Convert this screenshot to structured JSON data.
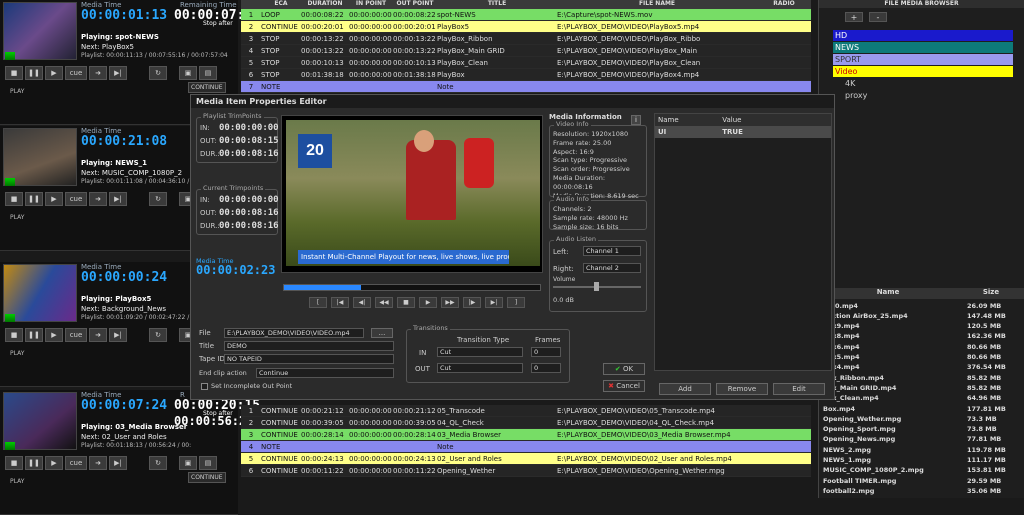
{
  "channels": [
    {
      "media_time_label": "Media Time",
      "media_time": "00:00:01:13",
      "remaining_label": "Remaining Time",
      "remaining": "00:00:07:09",
      "stop_after": "Stop after",
      "playing": "Playing: spot-NEWS",
      "next": "Next: PlayBox5",
      "playlist": "Playlist: 00:00:11:13 / 00:07:55:16 / 00:07:57:04",
      "mode": "CONTINUE",
      "state": "PLAY"
    },
    {
      "media_time_label": "Media Time",
      "media_time": "00:00:21:08",
      "remaining_label": "",
      "remaining": "",
      "stop_after": "",
      "playing": "Playing: NEWS_1",
      "next": "Next: MUSIC_COMP_1080P_2",
      "playlist": "Playlist: 00:01:11:08 / 00:04:36:10 / 00:",
      "mode": "",
      "state": "PLAY"
    },
    {
      "media_time_label": "Media Time",
      "media_time": "00:00:00:24",
      "remaining_label": "",
      "remaining": "",
      "stop_after": "",
      "playing": "Playing: PlayBox5",
      "next": "Next: Background_News",
      "playlist": "Playlist: 00:01:09:20 / 00:02:47:22 / 00:",
      "mode": "",
      "state": "PLAY"
    },
    {
      "media_time_label": "Media Time",
      "media_time": "00:00:07:24",
      "remaining_label": "R",
      "remaining": "00:00:20:15",
      "stop_after": "Stop after",
      "playing": "Playing: 03_Media Browser",
      "next": "Next: 02_User and Roles",
      "playlist": "Playlist: 00:01:18:13 / 00:56:24 / 00:",
      "mode": "CONTINUE",
      "state": "PLAY",
      "extra_time": "00:00:56:24"
    }
  ],
  "top_table": {
    "headers": [
      "",
      "ECA",
      "DURATION",
      "IN POINT",
      "OUT POINT",
      "TITLE",
      "FILE NAME",
      "RADIO"
    ],
    "rows": [
      {
        "n": "1",
        "eca": "LOOP",
        "dur": "00:00:08:22",
        "in": "00:00:00:00",
        "out": "00:00:08:22",
        "title": "spot-NEWS",
        "file": "E:\\Capture\\spot-NEWS.mov",
        "style": "green"
      },
      {
        "n": "2",
        "eca": "CONTINUE",
        "dur": "00:00:20:01",
        "in": "00:00:00:00",
        "out": "00:00:20:01",
        "title": "PlayBox5",
        "file": "E:\\PLAYBOX_DEMO\\VIDEO\\PlayBox5.mp4",
        "style": "yellow"
      },
      {
        "n": "3",
        "eca": "STOP",
        "dur": "00:00:13:22",
        "in": "00:00:00:00",
        "out": "00:00:13:22",
        "title": "PlayBox_Ribbon",
        "file": "E:\\PLAYBOX_DEMO\\VIDEO\\PlayBox_Ribbo",
        "style": "dark"
      },
      {
        "n": "4",
        "eca": "STOP",
        "dur": "00:00:13:22",
        "in": "00:00:00:00",
        "out": "00:00:13:22",
        "title": "PlayBox_Main GRID",
        "file": "E:\\PLAYBOX_DEMO\\VIDEO\\PlayBox_Main",
        "style": "dark"
      },
      {
        "n": "5",
        "eca": "STOP",
        "dur": "00:00:10:13",
        "in": "00:00:00:00",
        "out": "00:00:10:13",
        "title": "PlayBox_Clean",
        "file": "E:\\PLAYBOX_DEMO\\VIDEO\\PlayBox_Clean",
        "style": "dark"
      },
      {
        "n": "6",
        "eca": "STOP",
        "dur": "00:01:38:18",
        "in": "00:00:00:00",
        "out": "00:01:38:18",
        "title": "PlayBox",
        "file": "E:\\PLAYBOX_DEMO\\VIDEO\\PlayBox4.mp4",
        "style": "dark"
      },
      {
        "n": "7",
        "eca": "NOTE",
        "dur": "",
        "in": "",
        "out": "",
        "title": "Note",
        "file": "",
        "style": "blue"
      }
    ]
  },
  "bottom_table": {
    "rows": [
      {
        "n": "1",
        "eca": "CONTINUE",
        "dur": "00:00:21:12",
        "in": "00:00:00:00",
        "out": "00:00:21:12",
        "title": "05_Transcode",
        "file": "E:\\PLAYBOX_DEMO\\VIDEO\\05_Transcode.mp4",
        "style": "dark"
      },
      {
        "n": "2",
        "eca": "CONTINUE",
        "dur": "00:00:39:05",
        "in": "00:00:00:00",
        "out": "00:00:39:05",
        "title": "04_QL_Check",
        "file": "E:\\PLAYBOX_DEMO\\VIDEO\\04_QL_Check.mp4",
        "style": "dark"
      },
      {
        "n": "3",
        "eca": "CONTINUE",
        "dur": "00:00:28:14",
        "in": "00:00:00:00",
        "out": "00:00:28:14",
        "title": "03_Media Browser",
        "file": "E:\\PLAYBOX_DEMO\\VIDEO\\03_Media Browser.mp4",
        "style": "green"
      },
      {
        "n": "4",
        "eca": "NOTE",
        "dur": "",
        "in": "",
        "out": "",
        "title": "Note",
        "file": "",
        "style": "blue"
      },
      {
        "n": "5",
        "eca": "CONTINUE",
        "dur": "00:00:24:13",
        "in": "00:00:00:00",
        "out": "00:00:24:13",
        "title": "02_User and Roles",
        "file": "E:\\PLAYBOX_DEMO\\VIDEO\\02_User and Roles.mp4",
        "style": "yellow"
      },
      {
        "n": "6",
        "eca": "CONTINUE",
        "dur": "00:00:11:22",
        "in": "00:00:00:00",
        "out": "00:00:11:22",
        "title": "Opening_Wether",
        "file": "E:\\PLAYBOX_DEMO\\VIDEO\\Opening_Wether.mpg",
        "style": "dark"
      }
    ]
  },
  "browser": {
    "title": "FILE MEDIA BROWSER",
    "btn_add": "+",
    "btn_remove": "-",
    "categories": [
      {
        "label": "HD",
        "color": "#1a1acc",
        "text": "#fff"
      },
      {
        "label": "NEWS",
        "color": "#0d7a7a",
        "text": "#fff"
      },
      {
        "label": "SPORT",
        "color": "#9a9aee",
        "text": "#333"
      },
      {
        "label": "Video",
        "color": "#ffff00",
        "text": "#c00"
      }
    ],
    "sub": [
      "4K",
      "proxy"
    ],
    "file_headers": [
      "Name",
      "Size"
    ],
    "files": [
      {
        "name": "y_40.mp4",
        "size": "26.09 MB"
      },
      {
        "name": "duction AirBox_25.mp4",
        "size": "147.48 MB"
      },
      {
        "name": "Box9.mp4",
        "size": "120.5 MB"
      },
      {
        "name": "Box8.mp4",
        "size": "162.36 MB"
      },
      {
        "name": "Box6.mp4",
        "size": "80.66 MB"
      },
      {
        "name": "Box5.mp4",
        "size": "80.66 MB"
      },
      {
        "name": "Box4.mp4",
        "size": "376.54 MB"
      },
      {
        "name": "Box_Ribbon.mp4",
        "size": "85.82 MB"
      },
      {
        "name": "Box_Main GRID.mp4",
        "size": "85.82 MB"
      },
      {
        "name": "Box_Clean.mp4",
        "size": "64.96 MB"
      },
      {
        "name": "Box.mp4",
        "size": "177.81 MB"
      },
      {
        "name": "Opening_Wether.mpg",
        "size": "73.3 MB"
      },
      {
        "name": "Opening_Sport.mpg",
        "size": "73.8 MB"
      },
      {
        "name": "Opening_News.mpg",
        "size": "77.81 MB"
      },
      {
        "name": "NEWS_2.mpg",
        "size": "119.78 MB"
      },
      {
        "name": "NEWS_1.mpg",
        "size": "111.17 MB"
      },
      {
        "name": "MUSIC_COMP_1080P_2.mpg",
        "size": "153.81 MB"
      },
      {
        "name": "Football TIMER.mpg",
        "size": "29.59 MB"
      },
      {
        "name": "football2.mpg",
        "size": "35.06 MB"
      }
    ]
  },
  "dialog": {
    "title": "Media Item Properties Editor",
    "playlist_trim_label": "Playlist TrimPoints",
    "current_trim_label": "Current Trimpoints",
    "in_label": "IN:",
    "out_label": "OUT:",
    "dur_label": "DUR.:",
    "pl_in": "00:00:00:00",
    "pl_out": "00:00:08:15",
    "pl_dur": "00:00:08:16",
    "cur_in": "00:00:00:00",
    "cur_out": "00:00:08:16",
    "cur_dur": "00:00:08:16",
    "media_time_label": "Media Time",
    "media_time": "00:00:02:23",
    "caption": "Instant Multi-Channel Playout for news, live shows, live prod",
    "logo": "20",
    "media_info_title": "Media Information",
    "video_info_label": "Video Info",
    "video_info": [
      "Resolution: 1920x1080",
      "Frame rate: 25.00",
      "Aspect: 16:9",
      "Scan type: Progressive",
      "Scan order: Progressive",
      "Media Duration: 00:00:08:16",
      "Media Duration: 8.619 sec"
    ],
    "audio_info_label": "Audio Info",
    "audio_info": [
      "Channels: 2",
      "Sample rate: 48000 Hz",
      "Sample size: 16 bits"
    ],
    "audio_listen_label": "Audio Listen",
    "left_label": "Left:",
    "left_val": "Channel 1",
    "right_label": "Right:",
    "right_val": "Channel 2",
    "volume_label": "Volume",
    "volume_db": "0.0 dB",
    "prop_headers": [
      "Name",
      "Value"
    ],
    "props": [
      {
        "name": "UI",
        "value": "TRUE"
      }
    ],
    "prop_btns": [
      "Add",
      "Remove",
      "Edit"
    ],
    "file_label": "File",
    "file_val": "E:\\PLAYBOX_DEMO\\VIDEO\\VIDEO.mp4",
    "browse": "...",
    "title_label": "Title",
    "title_val": "DEMO",
    "tapeid_label": "Tape ID",
    "tapeid_val": "NO TAPEID",
    "endclip_label": "End clip action",
    "endclip_val": "Continue",
    "incomplete_label": "Set Incomplete Out Point",
    "transitions_label": "Transitions",
    "trans_type_label": "Transition Type",
    "frames_label": "Frames",
    "in_t": "IN",
    "in_t_val": "Cut",
    "in_f": "0",
    "out_t": "OUT",
    "out_t_val": "Cut",
    "out_f": "0",
    "ok": "OK",
    "cancel": "Cancel",
    "info_btn": "i",
    "timeline_progress": 0.3
  }
}
